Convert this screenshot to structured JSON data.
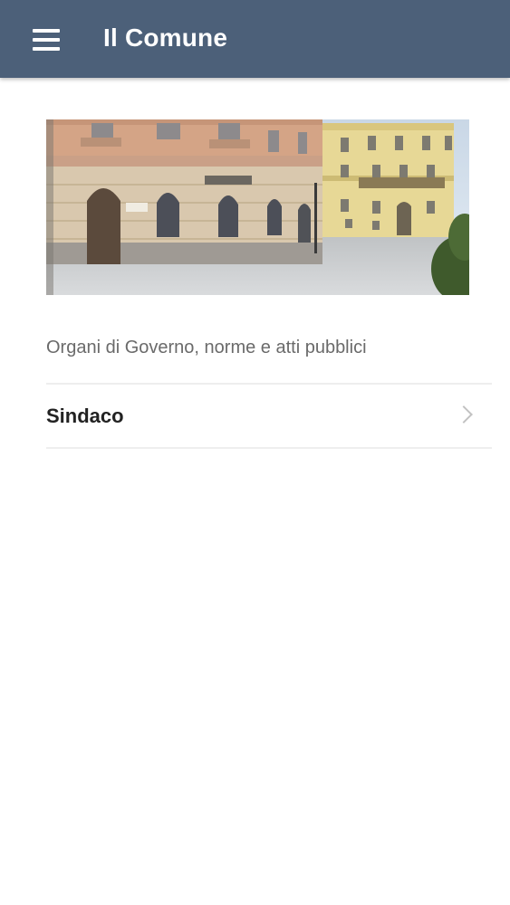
{
  "appbar": {
    "title": "Il Comune",
    "menu_icon": "menu-icon",
    "color": "#4c6079"
  },
  "section": {
    "description": "Organi di Governo, norme e atti pubblici"
  },
  "list": {
    "items": [
      {
        "label": "Sindaco",
        "icon": "chevron-right-icon"
      }
    ]
  }
}
